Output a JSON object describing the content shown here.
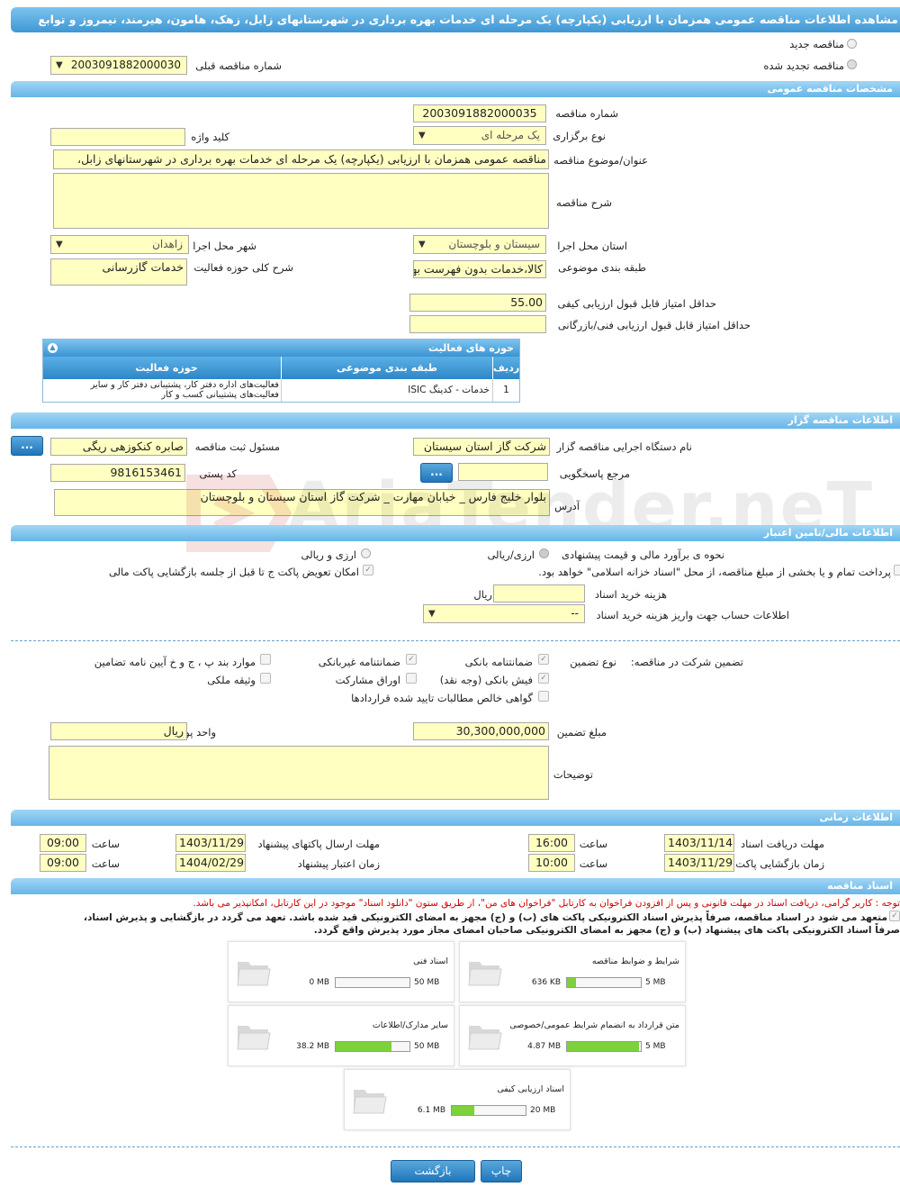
{
  "header": {
    "title": "مشاهده اطلاعات مناقصه عمومی همزمان با ارزیابی (یکپارچه) یک مرحله ای خدمات بهره برداری در شهرستانهای زابل، زهک، هامون، هیرمند، نیمروز و توابع"
  },
  "top": {
    "new_label": "مناقصه جدید",
    "renewed_label": "مناقصه تجدید شده",
    "prev_number_label": "شماره مناقصه قبلی",
    "prev_number_value": "2003091882000030"
  },
  "general": {
    "section_title": "مشخصات مناقصه عمومی",
    "number_label": "شماره مناقصه",
    "number_value": "2003091882000035",
    "type_label": "نوع برگزاری",
    "type_value": "یک مرحله ای",
    "keyword_label": "کلید واژه",
    "keyword_value": "",
    "subject_label": "عنوان/موضوع مناقصه",
    "subject_value": "مناقصه عمومی همزمان با ارزیابی (یکپارچه) یک مرحله ای خدمات بهره برداری در شهرستانهای زابل،",
    "desc_label": "شرح مناقصه",
    "desc_value": "",
    "province_label": "استان محل اجرا",
    "province_value": "سیستان و بلوچستان",
    "city_label": "شهر محل اجرا",
    "city_value": "زاهدان",
    "category_label": "طبقه بندی موضوعی",
    "category_value": "کالا،خدمات بدون فهرست بها",
    "scope_label": "شرح کلی حوزه فعالیت",
    "scope_value": "خدمات گازرسانی",
    "min_quality_label": "حداقل امتیاز قابل قبول ارزیابی کیفی",
    "min_quality_value": "55.00",
    "min_tech_label": "حداقل امتیاز قابل قبول ارزیابی فنی/بازرگانی",
    "min_tech_value": ""
  },
  "activity": {
    "title": "حوزه های فعالیت",
    "col_row": "ردیف",
    "col_category": "طبقه بندی موضوعی",
    "col_field": "حوزه فعالیت",
    "rows": [
      {
        "num": "1",
        "category": "خدمات - کدینگ ISIC",
        "field": "فعالیت‌های  اداره دفتر کار، پشتیبانی دفتر کار و سایر فعالیت‌های پشتیبانی کسب و کار"
      }
    ]
  },
  "organizer": {
    "section_title": "اطلاعات مناقصه گزار",
    "org_label": "نام دستگاه اجرایی مناقصه گزار",
    "org_value": "شرکت گاز استان سیستان",
    "resp_label": "مسئول ثبت مناقصه",
    "resp_value": "صابره کنکوزهی ریگی",
    "ref_label": "مرجع پاسخگویی",
    "ref_value": "",
    "postal_label": "کد پستی",
    "postal_value": "9816153461",
    "address_label": "آدرس",
    "address_value": "بلوار خلیج فارس _ خیابان مهارت _ شرکت گاز استان سیستان و بلوچستان",
    "dots": "..."
  },
  "finance": {
    "section_title": "اطلاعات مالی/تامین اعتبار",
    "estimate_label": "نحوه ی برآورد مالی و قیمت پیشنهادی",
    "rial_label": "ارزی/ریالی",
    "fx_label": "ارزی و ریالی",
    "treasury_label": "پرداخت تمام و یا بخشی از مبلغ مناقصه، از محل \"اسناد خزانه اسلامی\" خواهد بود.",
    "swap_label": "امکان تعویض پاکت ج تا قبل از جلسه بازگشایی پاکت مالی",
    "doc_fee_label": "هزینه خرید اسناد",
    "doc_fee_value": "",
    "doc_fee_unit": "ریال",
    "account_label": "اطلاعات حساب جهت واریز هزینه خرید اسناد",
    "account_value": "--"
  },
  "guarantee": {
    "title_label": "تضمین شرکت در مناقصه:",
    "type_label": "نوع تضمین",
    "bank_guarantee": "ضمانتنامه بانکی",
    "nonbank_guarantee": "ضمانتنامه غیربانکی",
    "clauses": "موارد بند پ ، ج و خ آیین نامه تضامین",
    "bank_receipt": "فیش بانکی (وجه نقد)",
    "bonds": "اوراق مشارکت",
    "property": "وثیقه ملکی",
    "receivables": "گواهی خالص مطالبات تایید شده قراردادها",
    "amount_label": "مبلغ تضمین",
    "amount_value": "30,300,000,000",
    "currency_label": "واحد پول",
    "currency_value": "ریال",
    "notes_label": "توضیحات",
    "notes_value": ""
  },
  "timing": {
    "section_title": "اطلاعات زمانی",
    "receive_label": "مهلت دریافت اسناد",
    "receive_date": "1403/11/14",
    "receive_time": "16:00",
    "send_label": "مهلت ارسال پاکتهای پیشنهاد",
    "send_date": "1403/11/29",
    "send_time": "09:00",
    "open_label": "زمان بازگشایی پاکت ها",
    "open_date": "1403/11/29",
    "open_time": "10:00",
    "valid_label": "زمان اعتبار پیشنهاد",
    "valid_date": "1404/02/29",
    "valid_time": "09:00",
    "hour_label": "ساعت"
  },
  "documents": {
    "section_title": "اسناد مناقصه",
    "notice": "توجه : کاربر گرامی، دریافت اسناد در مهلت قانونی و پس از افزودن فراخوان به کارتابل \"فراخوان های من\"، از طریق ستون \"دانلود اسناد\" موجود در این کارتابل، امکانپذیر می باشد.",
    "commit_line1": "متعهد می شود در اسناد مناقصه، صرفاً پذیرش اسناد الکترونیکی پاکت های (ب) و (ج) مجهز به امضای الکترونیکی قید شده باشد. تعهد می گردد در بازگشایی و پذیرش اسناد،",
    "commit_line2": "صرفاً اسناد الکترونیکی پاکت های پیشنهاد (ب) و (ج) مجهز به امضای الکترونیکی صاحبان امضای مجاز مورد پذیرش واقع گردد.",
    "files": [
      {
        "title": "شرایط و ضوابط مناقصه",
        "used": "636 KB",
        "max": "5 MB",
        "fill": 0.12
      },
      {
        "title": "اسناد فنی",
        "used": "0 MB",
        "max": "50 MB",
        "fill": 0.0
      },
      {
        "title": "متن قرارداد به انضمام شرایط عمومی/خصوصی",
        "used": "4.87 MB",
        "max": "5 MB",
        "fill": 0.97
      },
      {
        "title": "سایر مدارک/اطلاعات",
        "used": "38.2 MB",
        "max": "50 MB",
        "fill": 0.76
      },
      {
        "title": "اسناد ارزیابی کیفی",
        "used": "6.1 MB",
        "max": "20 MB",
        "fill": 0.3
      }
    ]
  },
  "footer": {
    "print_label": "چاپ",
    "back_label": "بازگشت"
  },
  "colors": {
    "header": "#3f97d4",
    "field_bg": "#ffffc2",
    "progress": "#7bd23a",
    "notice_red": "#d00000"
  }
}
